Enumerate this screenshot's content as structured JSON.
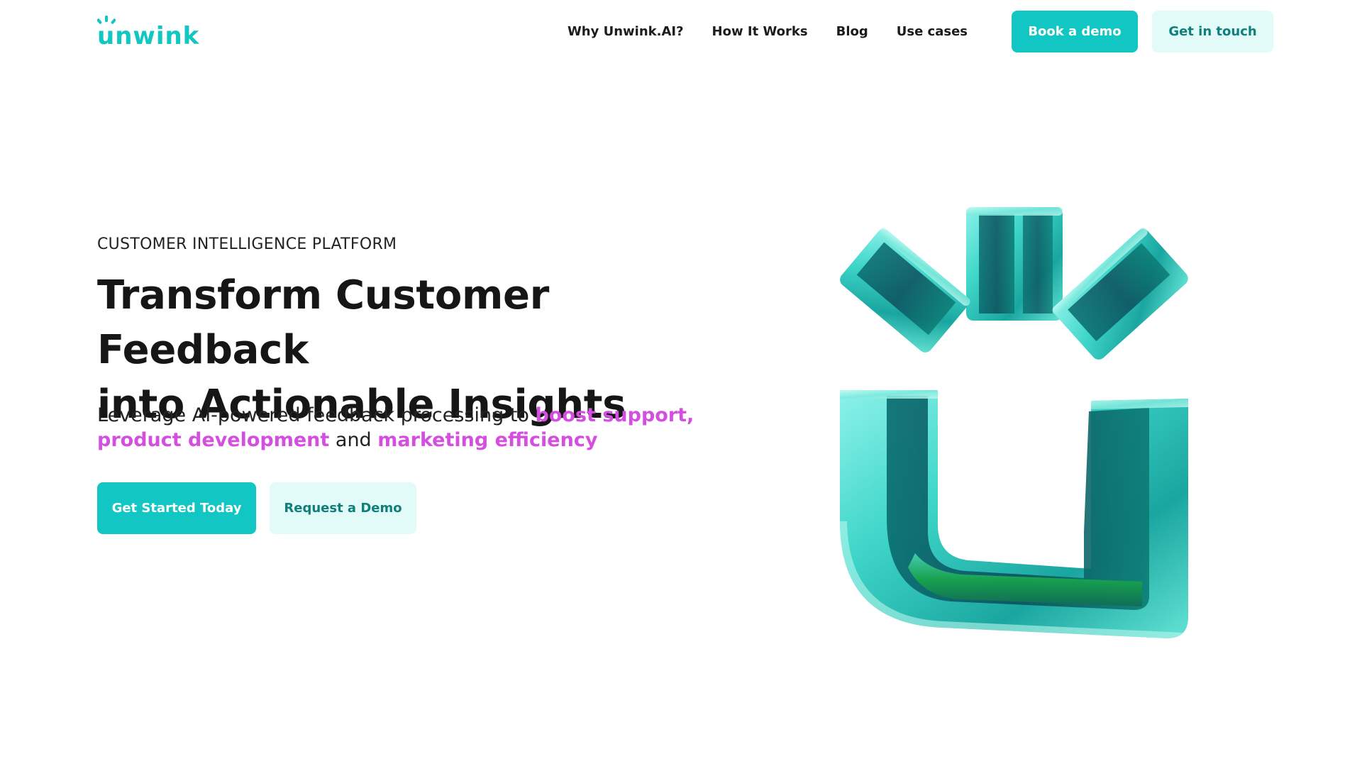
{
  "brand": {
    "name": "unwink",
    "logo_icon": "unwink-logo-icon",
    "accent_color": "#12c7c3",
    "highlight_color": "#d44ee0"
  },
  "nav": {
    "links": [
      "Why Unwink.AI?",
      "How It Works",
      "Blog",
      "Use cases"
    ],
    "book_demo_label": "Book a demo",
    "get_in_touch_label": "Get in touch"
  },
  "hero": {
    "eyebrow": "CUSTOMER INTELLIGENCE PLATFORM",
    "headline_line1": "Transform Customer Feedback",
    "headline_line2": "into Actionable Insights",
    "subhead_part1": "Leverage AI-powered feedback processing to ",
    "subhead_highlight1": "boost support, product development",
    "subhead_part2": " and ",
    "subhead_highlight2": "marketing efficiency",
    "cta_primary_label": "Get Started Today",
    "cta_secondary_label": "Request a Demo",
    "illustration_icon": "unwink-3d-logo-icon"
  }
}
